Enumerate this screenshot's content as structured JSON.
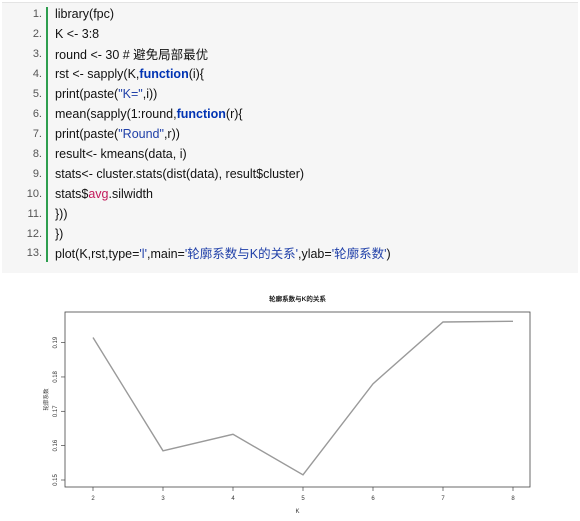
{
  "code": {
    "lines": [
      {
        "num": "1.",
        "parts": [
          {
            "t": "library(fpc)",
            "c": ""
          }
        ]
      },
      {
        "num": "2.",
        "parts": [
          {
            "t": "K <- 3:8",
            "c": ""
          }
        ]
      },
      {
        "num": "3.",
        "parts": [
          {
            "t": "round <- 30 # 避免局部最优",
            "c": ""
          }
        ]
      },
      {
        "num": "4.",
        "parts": [
          {
            "t": "rst <- sapply(K,",
            "c": ""
          },
          {
            "t": "function",
            "c": "kw"
          },
          {
            "t": "(i){",
            "c": ""
          }
        ]
      },
      {
        "num": "5.",
        "parts": [
          {
            "t": "print(paste(",
            "c": ""
          },
          {
            "t": "\"K=\"",
            "c": "str"
          },
          {
            "t": ",i))",
            "c": ""
          }
        ]
      },
      {
        "num": "6.",
        "parts": [
          {
            "t": "mean(sapply(1:round,",
            "c": ""
          },
          {
            "t": "function",
            "c": "kw"
          },
          {
            "t": "(r){",
            "c": ""
          }
        ]
      },
      {
        "num": "7.",
        "parts": [
          {
            "t": "print(paste(",
            "c": ""
          },
          {
            "t": "\"Round\"",
            "c": "str"
          },
          {
            "t": ",r))",
            "c": ""
          }
        ]
      },
      {
        "num": "8.",
        "parts": [
          {
            "t": "result<- kmeans(data, i)",
            "c": ""
          }
        ]
      },
      {
        "num": "9.",
        "parts": [
          {
            "t": "stats<- cluster.stats(dist(data), result$cluster)",
            "c": ""
          }
        ]
      },
      {
        "num": "10.",
        "parts": [
          {
            "t": "stats$",
            "c": ""
          },
          {
            "t": "avg",
            "c": "attr"
          },
          {
            "t": ".silwidth",
            "c": ""
          }
        ]
      },
      {
        "num": "11.",
        "parts": [
          {
            "t": "}))",
            "c": ""
          }
        ]
      },
      {
        "num": "12.",
        "parts": [
          {
            "t": "})",
            "c": ""
          }
        ]
      },
      {
        "num": "13.",
        "parts": [
          {
            "t": "plot(K,rst,type=",
            "c": ""
          },
          {
            "t": "'l'",
            "c": "str"
          },
          {
            "t": ",main=",
            "c": ""
          },
          {
            "t": "'轮廓系数与K的关系'",
            "c": "str"
          },
          {
            "t": ",ylab=",
            "c": ""
          },
          {
            "t": "'轮廓系数'",
            "c": "str"
          },
          {
            "t": ")",
            "c": ""
          }
        ]
      }
    ]
  },
  "chart_data": {
    "type": "line",
    "title": "轮廓系数与K的关系",
    "xlabel": "K",
    "ylabel": "轮廓系数",
    "x": [
      2,
      3,
      4,
      5,
      6,
      7,
      8
    ],
    "values": [
      0.1915,
      0.1585,
      0.1633,
      0.1515,
      0.178,
      0.196,
      0.1962
    ],
    "xlim": [
      2,
      8
    ],
    "ylim": [
      0.15,
      0.196
    ],
    "xticks": [
      "2",
      "3",
      "4",
      "5",
      "6",
      "7",
      "8"
    ],
    "yticks": [
      "0.15",
      "0.16",
      "0.17",
      "0.18",
      "0.19"
    ],
    "ytick_values": [
      0.15,
      0.16,
      0.17,
      0.18,
      0.19
    ],
    "line_color": "#9a9a9a",
    "grid": false
  }
}
